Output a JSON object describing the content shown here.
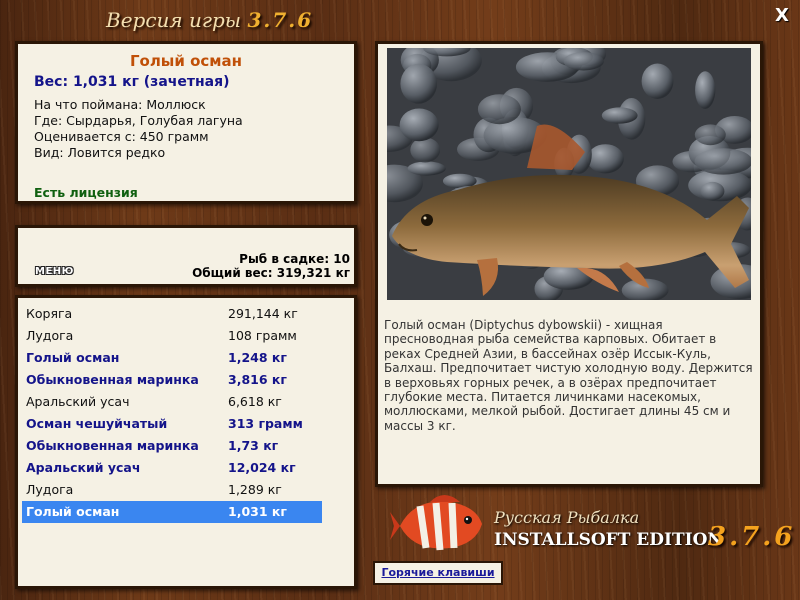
{
  "title_bar": {
    "prefix": "Версия игры",
    "version": "3.7.6",
    "close_label": "X"
  },
  "fish_info": {
    "name": "Голый осман",
    "weight_line": "Вес: 1,031 кг (зачетная)",
    "bait": "На что поймана: Моллюск",
    "location": "Где: Сырдарья, Голубая лагуна",
    "rated_from": "Оценивается с: 450 грамм",
    "rarity": "Вид: Ловится редко",
    "license": "Есть лицензия"
  },
  "cage": {
    "menu_label": "МЕНЮ",
    "count": "Рыб в садке: 10",
    "total_weight": "Общий вес: 319,321 кг"
  },
  "catch_list": [
    {
      "name": "Коряга",
      "weight": "291,144 кг",
      "bold": false,
      "selected": false
    },
    {
      "name": "Лудога",
      "weight": "108 грамм",
      "bold": false,
      "selected": false
    },
    {
      "name": "Голый осман",
      "weight": "1,248 кг",
      "bold": true,
      "selected": false
    },
    {
      "name": "Обыкновенная маринка",
      "weight": "3,816 кг",
      "bold": true,
      "selected": false
    },
    {
      "name": "Аральский усач",
      "weight": "6,618 кг",
      "bold": false,
      "selected": false
    },
    {
      "name": "Осман чешуйчатый",
      "weight": "313 грамм",
      "bold": true,
      "selected": false
    },
    {
      "name": "Обыкновенная маринка",
      "weight": "1,73 кг",
      "bold": true,
      "selected": false
    },
    {
      "name": "Аральский усач",
      "weight": "12,024 кг",
      "bold": true,
      "selected": false
    },
    {
      "name": "Лудога",
      "weight": "1,289 кг",
      "bold": false,
      "selected": false
    },
    {
      "name": "Голый осман",
      "weight": "1,031 кг",
      "bold": true,
      "selected": true
    }
  ],
  "description": "Голый осман (Diptychus dybowskii) - хищная пресноводная рыба семейства карповых. Обитает в реках Средней Азии, в бассейнах озёр Иссык-Куль, Балхаш. Предпочитает чистую холодную воду. Держится в верховьях горных речек, а в озёрах предпочитает глубокие места. Питается личинками насекомых, моллюсками, мелкой рыбой. Достигает длины 45 см и массы 3 кг.",
  "branding": {
    "game_name": "Русская Рыбалка",
    "edition": "INSTALLSOFT EDITION",
    "version": "3.7.6"
  },
  "hotkeys_label": "Горячие клавиши",
  "icons": {
    "close": "close-icon",
    "photo": "fish-photo",
    "logo": "logo-fish-icon"
  },
  "colors": {
    "fish_name": "#c05008",
    "weight": "#14148a",
    "license": "#106010",
    "selection": "#3a86f0",
    "version_accent": "#f4a21e"
  }
}
